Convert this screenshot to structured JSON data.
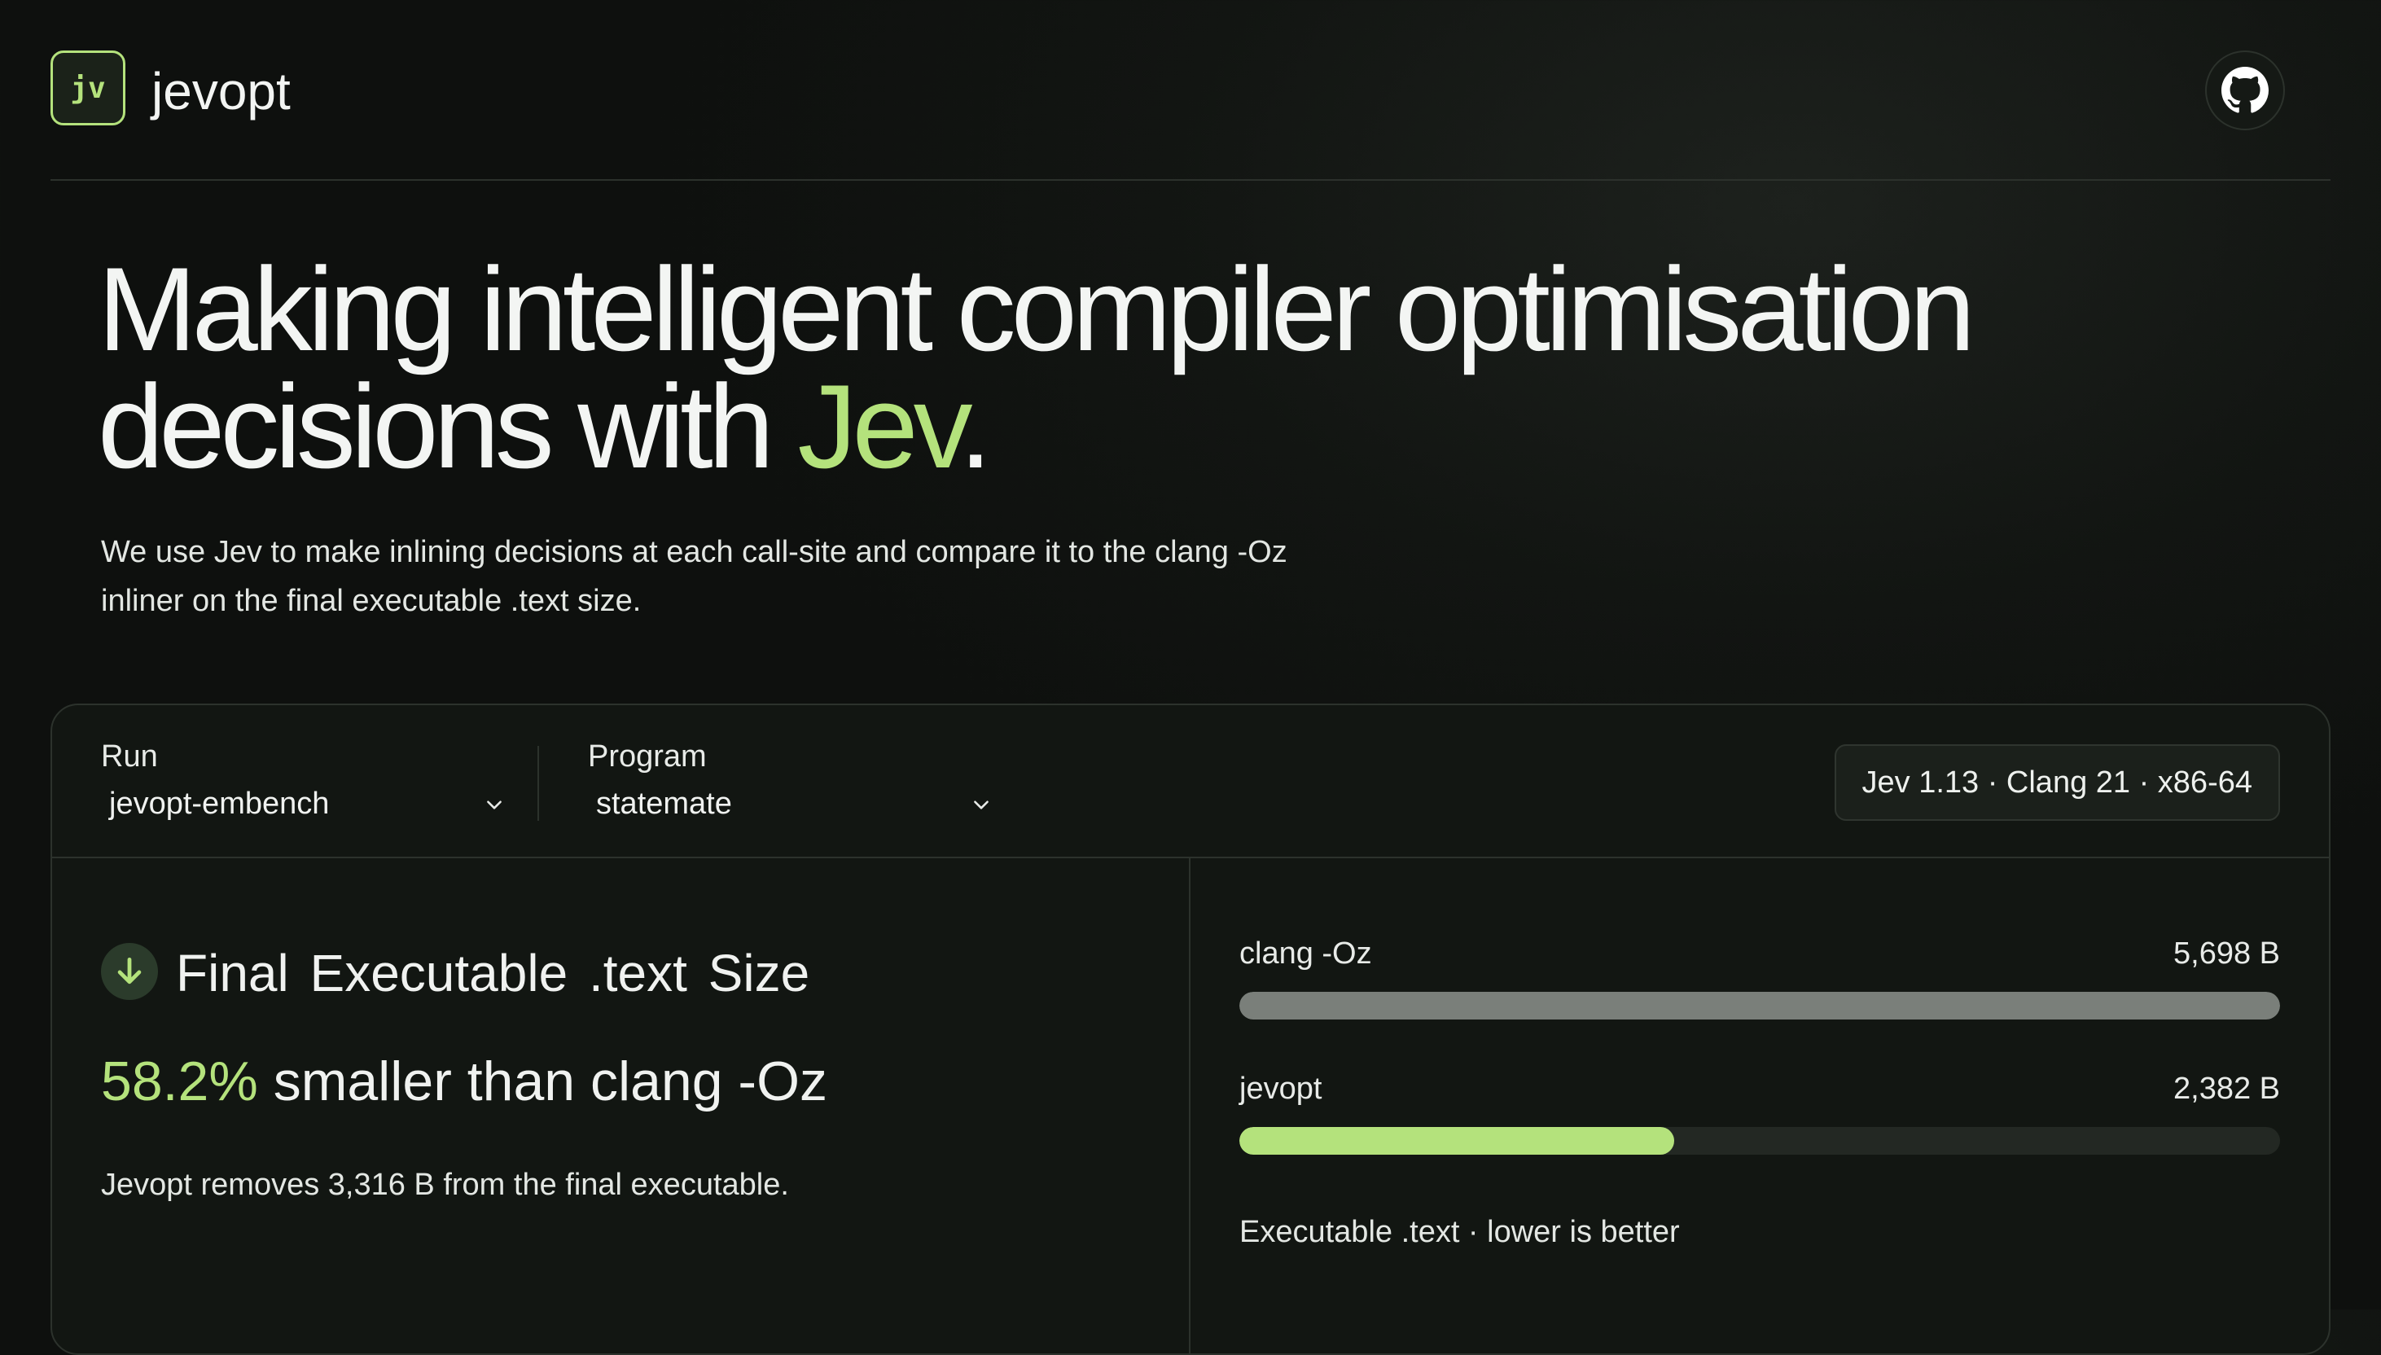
{
  "header": {
    "logo_text": "jv",
    "brand": "jevopt",
    "github_icon": "github-icon"
  },
  "hero": {
    "title_line1": "Making intelligent compiler optimisation",
    "title_line2_prefix": "decisions with ",
    "title_accent": "Jev",
    "title_suffix": ".",
    "subtitle_line1": "We use Jev to make inlining decisions at each call-site and compare it to the clang -Oz",
    "subtitle_line2": "inliner on the final executable .text size."
  },
  "controls": {
    "run_label": "Run",
    "run_value": "jevopt-embench",
    "program_label": "Program",
    "program_value": "statemate",
    "version_badge": "Jev 1.13 · Clang 21 · x86-64"
  },
  "metric": {
    "icon": "arrow-down-icon",
    "title_a": "Final Executable",
    "title_b": ".text",
    "title_c": "Size",
    "percent": "58.2%",
    "comparison": " smaller than clang -Oz",
    "note": "Jevopt removes 3,316 B from the final executable."
  },
  "bars": [
    {
      "label": "clang -Oz",
      "value_text": "5,698 B",
      "value": 5698,
      "fraction": 1.0,
      "color": "#7a7f7a"
    },
    {
      "label": "jevopt",
      "value_text": "2,382 B",
      "value": 2382,
      "fraction": 0.418,
      "color": "#b4e27c"
    }
  ],
  "bars_caption": "Executable .text · lower is better",
  "colors": {
    "accent": "#b4e27c",
    "background": "#121512"
  }
}
